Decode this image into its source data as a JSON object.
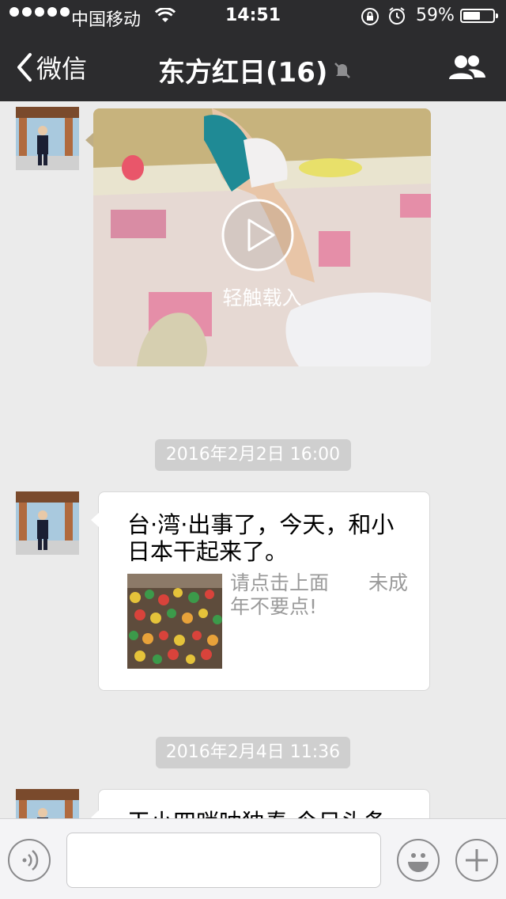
{
  "status_bar": {
    "carrier": "中国移动",
    "time": "14:51",
    "battery_percent": "59%",
    "battery_level": 0.59,
    "signal_dots": 5
  },
  "nav": {
    "back_label": "微信",
    "title": "东方红日(16)",
    "icons": [
      "chevron-left-icon",
      "mute-bell-icon",
      "group-members-icon"
    ]
  },
  "messages": [
    {
      "type": "video",
      "label": "轻触载入"
    },
    {
      "type": "timestamp",
      "text": "2016年2月2日 16:00"
    },
    {
      "type": "link",
      "text": "台·湾·出事了，今天，和小日本干起来了。",
      "description": "请点击上面　　未成年不要点!"
    },
    {
      "type": "timestamp",
      "text": "2016年2月4日 11:36"
    },
    {
      "type": "text",
      "text": "干小四哨呐独奏 今日头条"
    }
  ],
  "input_bar": {
    "value": "",
    "icons": [
      "voice-icon",
      "emoji-icon",
      "plus-icon"
    ]
  },
  "colors": {
    "bar_background": "#2c2c2e",
    "chat_background": "#ebebeb",
    "timestamp_background": "#cfcfcf"
  }
}
